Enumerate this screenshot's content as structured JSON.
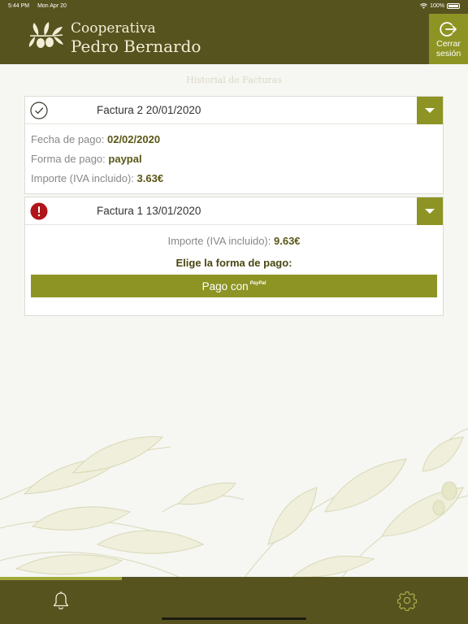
{
  "status_bar": {
    "time": "5:44 PM",
    "date": "Mon Apr 20",
    "battery": "100%"
  },
  "header": {
    "brand_line1": "Cooperativa",
    "brand_line2": "Pedro Bernardo",
    "logout_line1": "Cerrar",
    "logout_line2": "sesión"
  },
  "page": {
    "title": "Historial de Facturas"
  },
  "invoices": [
    {
      "title": "Factura 2 20/01/2020",
      "status": "paid",
      "details": [
        {
          "label": "Fecha de pago:",
          "value": "02/02/2020"
        },
        {
          "label": "Forma de pago:",
          "value": "paypal"
        },
        {
          "label": "Importe (IVA incluido):",
          "value": "3.63€"
        }
      ]
    },
    {
      "title": "Factura 1 13/01/2020",
      "status": "pending",
      "amount_label": "Importe (IVA incluido):",
      "amount_value": "9.63€",
      "choose_label": "Elige la forma de pago:",
      "pay_button_label": "Pago con",
      "pay_button_brand": "PayPal"
    }
  ],
  "progress": {
    "fraction": 0.26
  },
  "icons": {
    "paid": "check-circle-icon",
    "pending": "exclamation-circle-icon",
    "logout": "logout-icon",
    "footer_left": "bell-icon",
    "footer_right": "gear-icon"
  },
  "colors": {
    "primary_dark": "#57531f",
    "accent": "#8d9423",
    "alert": "#b0151a"
  }
}
